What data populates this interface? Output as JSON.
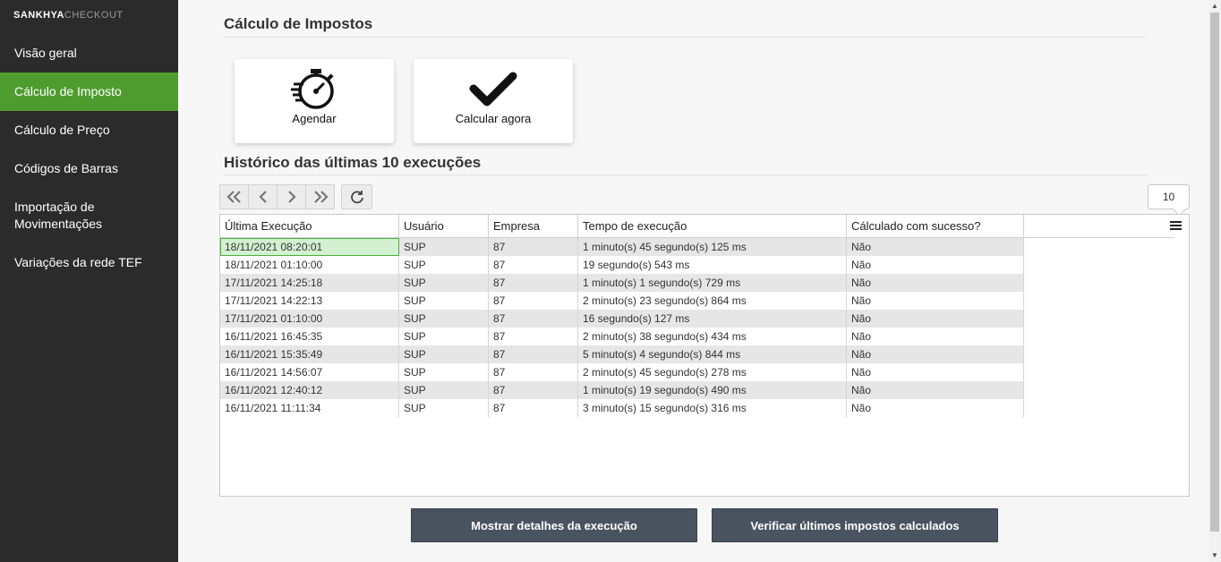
{
  "logo": {
    "part1": "SANKHYA",
    "part2": "CHECKOUT"
  },
  "sidebar": {
    "items": [
      {
        "label": "Visão geral"
      },
      {
        "label": "Cálculo de Imposto",
        "active": true
      },
      {
        "label": "Cálculo de Preço"
      },
      {
        "label": "Códigos de Barras"
      },
      {
        "label": "Importação de Movimentações"
      },
      {
        "label": "Variações da rede TEF"
      }
    ],
    "active_color": "#4f9c2e"
  },
  "page": {
    "title": "Cálculo de Impostos"
  },
  "actions": {
    "schedule_label": "Agendar",
    "schedule_icon": "stopwatch-icon",
    "calculate_label": "Calcular agora",
    "calculate_icon": "checkmark-icon"
  },
  "history": {
    "title": "Histórico das últimas 10 execuções",
    "page_size": "10",
    "columns": [
      "Última Execução",
      "Usuário",
      "Empresa",
      "Tempo de execução",
      "Cálculado com sucesso?"
    ],
    "rows": [
      [
        "18/11/2021 08:20:01",
        "SUP",
        "87",
        "1 minuto(s) 45 segundo(s) 125 ms",
        "Não"
      ],
      [
        "18/11/2021 01:10:00",
        "SUP",
        "87",
        "19 segundo(s) 543 ms",
        "Não"
      ],
      [
        "17/11/2021 14:25:18",
        "SUP",
        "87",
        "1 minuto(s) 1 segundo(s) 729 ms",
        "Não"
      ],
      [
        "17/11/2021 14:22:13",
        "SUP",
        "87",
        "2 minuto(s) 23 segundo(s) 864 ms",
        "Não"
      ],
      [
        "17/11/2021 01:10:00",
        "SUP",
        "87",
        "16 segundo(s) 127 ms",
        "Não"
      ],
      [
        "16/11/2021 16:45:35",
        "SUP",
        "87",
        "2 minuto(s) 38 segundo(s) 434 ms",
        "Não"
      ],
      [
        "16/11/2021 15:35:49",
        "SUP",
        "87",
        "5 minuto(s) 4 segundo(s) 844 ms",
        "Não"
      ],
      [
        "16/11/2021 14:56:07",
        "SUP",
        "87",
        "2 minuto(s) 45 segundo(s) 278 ms",
        "Não"
      ],
      [
        "16/11/2021 12:40:12",
        "SUP",
        "87",
        "1 minuto(s) 19 segundo(s) 490 ms",
        "Não"
      ],
      [
        "16/11/2021 11:11:34",
        "SUP",
        "87",
        "3 minuto(s) 15 segundo(s) 316 ms",
        "Não"
      ]
    ]
  },
  "buttons": {
    "details_label": "Mostrar detalhes da execução",
    "verify_label": "Verificar últimos impostos calculados"
  }
}
